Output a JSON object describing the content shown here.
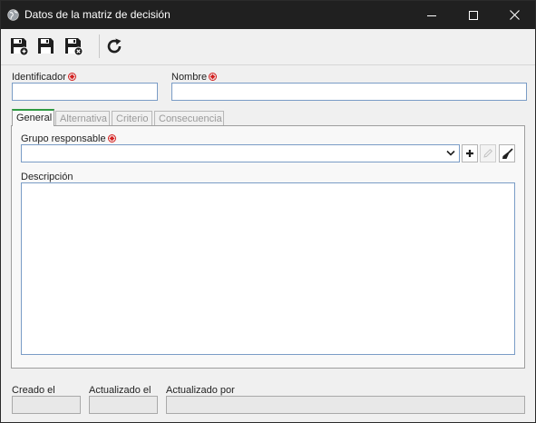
{
  "window": {
    "title": "Datos de la matriz de decisión"
  },
  "toolbar": {
    "buttons": [
      "save-and-new-icon",
      "save-icon",
      "save-and-close-icon",
      "refresh-icon"
    ]
  },
  "form": {
    "identifier_label": "Identificador",
    "name_label": "Nombre",
    "identifier_value": "",
    "name_value": ""
  },
  "tabs": [
    {
      "label": "General",
      "active": true
    },
    {
      "label": "Alternativa",
      "active": false
    },
    {
      "label": "Criterio",
      "active": false
    },
    {
      "label": "Consecuencia",
      "active": false
    }
  ],
  "general": {
    "group_label": "Grupo responsable",
    "group_value": "",
    "description_label": "Descripción",
    "description_value": ""
  },
  "footer": {
    "created_label": "Creado el",
    "updated_label": "Actualizado el",
    "updated_by_label": "Actualizado por"
  },
  "colors": {
    "titlebar": "#202020",
    "required": "#d42020",
    "active_tab": "#2e9a42",
    "input_border": "#7a9cc6"
  }
}
